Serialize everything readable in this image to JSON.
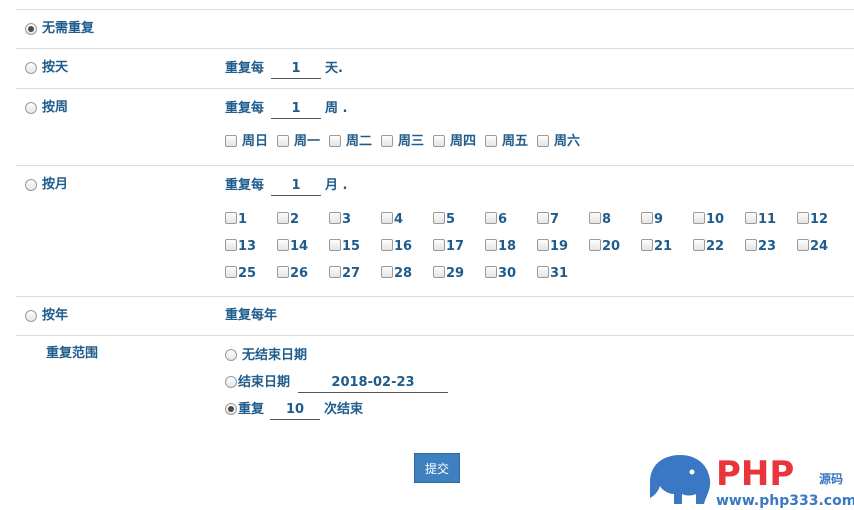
{
  "options": {
    "none": "无需重复",
    "daily": "按天",
    "weekly": "按周",
    "monthly": "按月",
    "yearly": "按年"
  },
  "daily": {
    "prefix": "重复每",
    "value": "1",
    "suffix": "天."
  },
  "weekly": {
    "prefix": "重复每",
    "value": "1",
    "suffix": "周 .",
    "days": [
      "周日",
      "周一",
      "周二",
      "周三",
      "周四",
      "周五",
      "周六"
    ]
  },
  "monthly": {
    "prefix": "重复每",
    "value": "1",
    "suffix": "月 .",
    "days": [
      "1",
      "2",
      "3",
      "4",
      "5",
      "6",
      "7",
      "8",
      "9",
      "10",
      "11",
      "12",
      "13",
      "14",
      "15",
      "16",
      "17",
      "18",
      "19",
      "20",
      "21",
      "22",
      "23",
      "24",
      "25",
      "26",
      "27",
      "28",
      "29",
      "30",
      "31"
    ]
  },
  "yearly": {
    "text": "重复每年"
  },
  "range": {
    "label": "重复范围",
    "no_end": "无结束日期",
    "end_date_label": "结束日期",
    "end_date_value": "2018-02-23",
    "repeat_label": "重复",
    "repeat_value": "10",
    "repeat_suffix": "次结束"
  },
  "submit_label": "提交",
  "watermark": {
    "brand": "PHP",
    "cn": "源码",
    "url": "www.php333.com"
  },
  "colors": {
    "text": "#1f5c8c",
    "button": "#3f80c0",
    "watermark_blue": "#3b78c3",
    "watermark_red": "#e8343a"
  }
}
